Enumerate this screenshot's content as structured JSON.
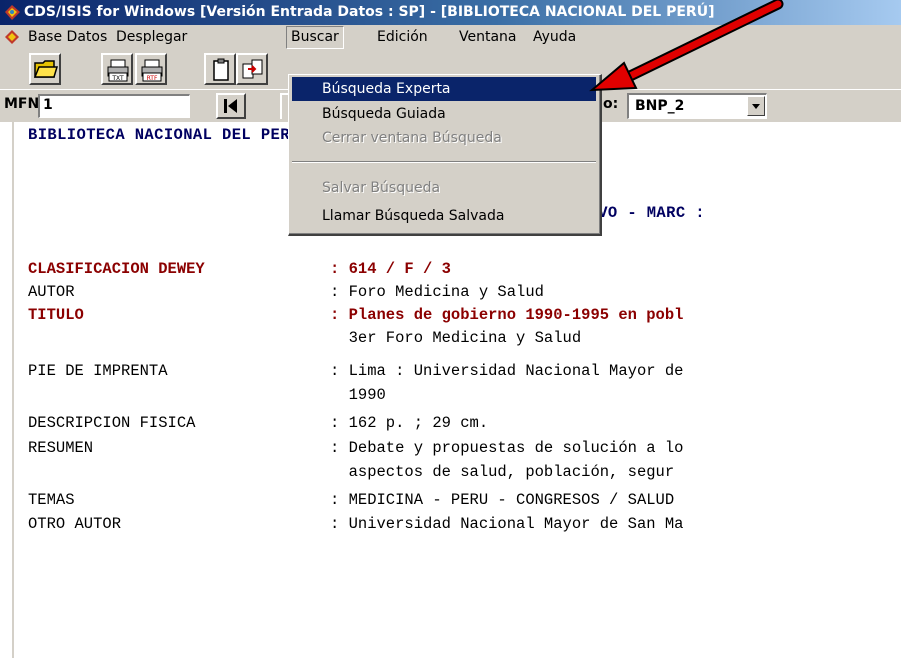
{
  "window": {
    "title": "CDS/ISIS for Windows [Versión Entrada Datos : SP] - [BIBLIOTECA NACIONAL DEL PERÚ]"
  },
  "menubar": {
    "items": [
      "Base Datos",
      "Desplegar",
      "Buscar",
      "Edición",
      "Ventana",
      "Ayuda"
    ],
    "open_item": "Buscar"
  },
  "buscar_menu": {
    "items": [
      {
        "label": "Búsqueda Experta",
        "state": "highlighted"
      },
      {
        "label": "Búsqueda Guiada",
        "state": "enabled"
      },
      {
        "label": "Cerrar ventana Búsqueda",
        "state": "disabled"
      },
      {
        "label": "Salvar Búsqueda",
        "state": "disabled"
      },
      {
        "label": "Llamar Búsqueda Salvada",
        "state": "enabled"
      }
    ]
  },
  "toolbar": {
    "icons": [
      "open-folder-icon",
      "print-txt-icon",
      "print-rtf-icon",
      "clipboard-icon",
      "copy-record-icon"
    ],
    "txt_label": "TXT",
    "rtf_label": "RTF"
  },
  "record_bar": {
    "mfn_label": "MFN",
    "mfn_value": "1",
    "db_label": "o:",
    "db_value": "BNP_2"
  },
  "record": {
    "header_line1": "BIBLIOTECA NACIONAL DEL PERÚ",
    "header_line2": "OLECTIVO - MARC :",
    "fields": [
      {
        "name": "CLASIFICACION DEWEY",
        "value": ": 614 / F / 3",
        "highlight": true
      },
      {
        "name": "AUTOR",
        "value": ": Foro Medicina y Salud",
        "highlight": false
      },
      {
        "name": "TITULO",
        "value": ": Planes de gobierno 1990-1995 en pobl",
        "highlight": true
      },
      {
        "name": "",
        "value": "  3er Foro Medicina y Salud",
        "highlight": false
      },
      {
        "name": "PIE DE IMPRENTA",
        "value": ": Lima : Universidad Nacional Mayor de",
        "highlight": false
      },
      {
        "name": "",
        "value": "  1990",
        "highlight": false
      },
      {
        "name": "DESCRIPCION FISICA",
        "value": ": 162 p. ; 29 cm.",
        "highlight": false
      },
      {
        "name": "RESUMEN",
        "value": ": Debate y propuestas de solución a lo",
        "highlight": false
      },
      {
        "name": "",
        "value": "  aspectos de salud, población, segur",
        "highlight": false
      },
      {
        "name": "TEMAS",
        "value": ": MEDICINA - PERU - CONGRESOS / SALUD",
        "highlight": false
      },
      {
        "name": "OTRO AUTOR",
        "value": ": Universidad Nacional Mayor de San Ma",
        "highlight": false
      }
    ]
  },
  "colors": {
    "titlebar": "#0a246a",
    "menu_highlight": "#0a246a",
    "field_red": "#8b0000",
    "header_blue": "#000060",
    "arrow": "#e00000"
  }
}
